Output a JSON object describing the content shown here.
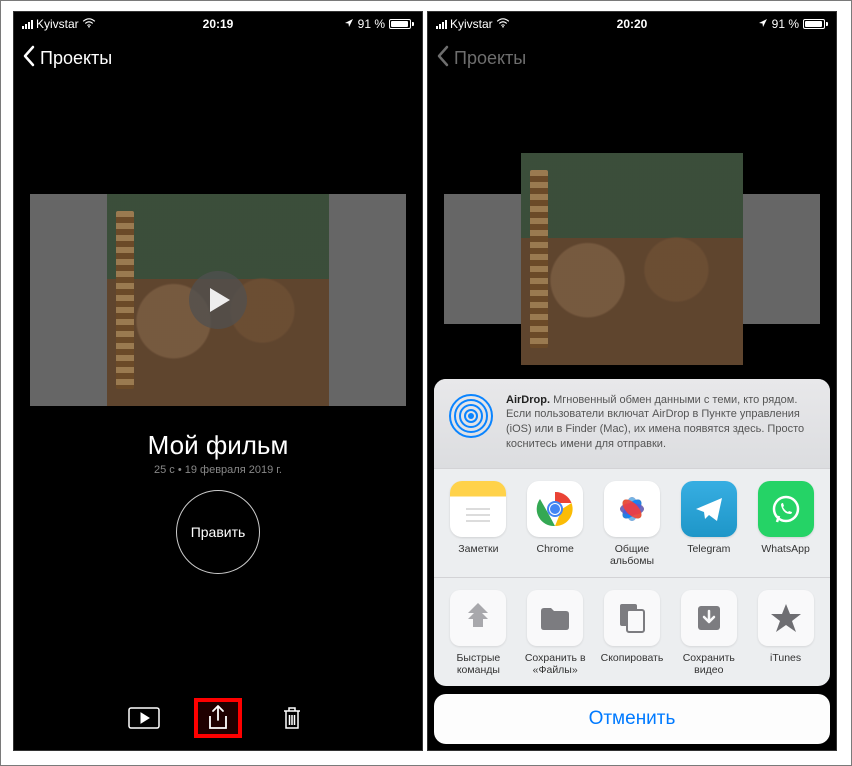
{
  "left": {
    "status": {
      "carrier": "Kyivstar",
      "time": "20:19",
      "battery_text": "91 %"
    },
    "nav": {
      "back": "Проекты"
    },
    "project": {
      "title": "Мой фильм",
      "meta": "25 с • 19 февраля 2019 г.",
      "edit": "Править"
    }
  },
  "right": {
    "status": {
      "carrier": "Kyivstar",
      "time": "20:20",
      "battery_text": "91 %"
    },
    "nav": {
      "back": "Проекты"
    },
    "airdrop": {
      "title": "AirDrop.",
      "text": "Мгновенный обмен данными с теми, кто рядом. Если пользователи включат AirDrop в Пункте управления (iOS) или в Finder (Mac), их имена появятся здесь. Просто коснитесь имени для отправки."
    },
    "apps": [
      {
        "label": "Заметки"
      },
      {
        "label": "Chrome"
      },
      {
        "label": "Общие альбомы"
      },
      {
        "label": "Telegram"
      },
      {
        "label": "WhatsApp"
      }
    ],
    "actions": [
      {
        "label": "Быстрые команды"
      },
      {
        "label": "Сохранить в «Файлы»"
      },
      {
        "label": "Скопировать"
      },
      {
        "label": "Сохранить видео"
      },
      {
        "label": "iTunes"
      }
    ],
    "cancel": "Отменить"
  }
}
